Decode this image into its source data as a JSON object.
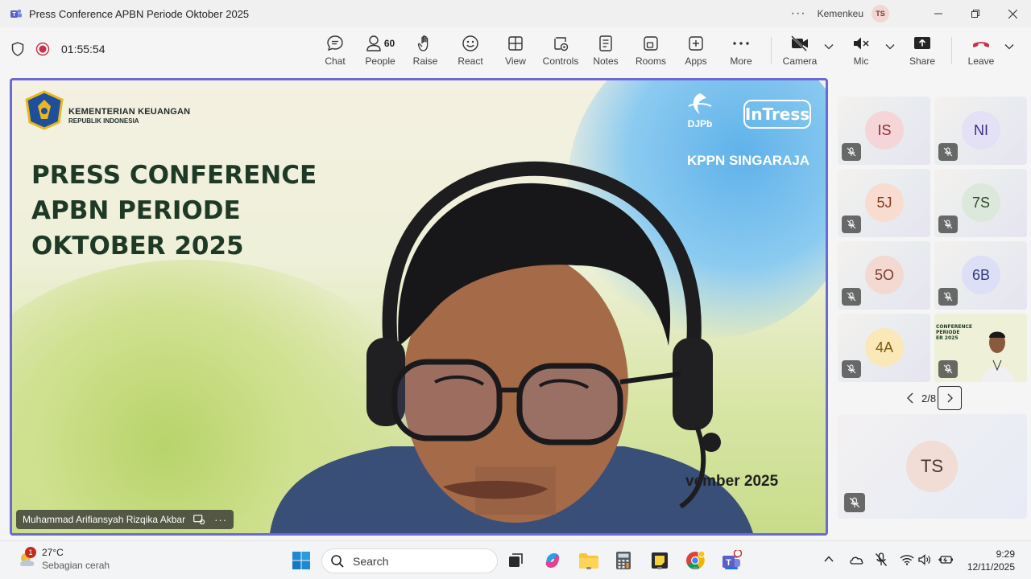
{
  "window": {
    "title": "Press Conference APBN Periode Oktober 2025",
    "org": "Kemenkeu",
    "user_initials": "TS"
  },
  "toolbar": {
    "timer": "01:55:54",
    "people_count": "60",
    "items": {
      "chat": "Chat",
      "people": "People",
      "raise": "Raise",
      "react": "React",
      "view": "View",
      "controls": "Controls",
      "notes": "Notes",
      "rooms": "Rooms",
      "apps": "Apps",
      "more": "More",
      "camera": "Camera",
      "mic": "Mic",
      "share": "Share",
      "leave": "Leave"
    },
    "leave_color": "#c4314b"
  },
  "main_video": {
    "ministry_line1": "KEMENTERIAN KEUANGAN",
    "ministry_line2": "REPUBLIK INDONESIA",
    "title_lines": [
      "PRESS CONFERENCE",
      "APBN PERIODE",
      "OKTOBER 2025"
    ],
    "djpb": "DJPb",
    "intress": "InTress",
    "kppn": "KPPN SINGARAJA",
    "date_fragment": "vember 2025",
    "speaker_name": "Muhammad Arifiansyah Rizqika Akbar",
    "border_color": "#6b69d6"
  },
  "gallery": {
    "tiles": [
      {
        "initials": "IS",
        "bg": "#f6d5d8",
        "fg": "#8a2a35"
      },
      {
        "initials": "NI",
        "bg": "#e4e0f5",
        "fg": "#3b2f7a"
      },
      {
        "initials": "5J",
        "bg": "#f8dcd0",
        "fg": "#8a3a1e"
      },
      {
        "initials": "7S",
        "bg": "#dde8dc",
        "fg": "#2e4a2c"
      },
      {
        "initials": "5O",
        "bg": "#f3d9d2",
        "fg": "#7a3a2a"
      },
      {
        "initials": "6B",
        "bg": "#dcdff5",
        "fg": "#2f3a7a"
      },
      {
        "initials": "4A",
        "bg": "#fbe8b8",
        "fg": "#7a5a10"
      }
    ],
    "pager": "2/8",
    "self_initials": "TS"
  },
  "taskbar": {
    "weather_badge": "1",
    "temperature": "27°C",
    "condition": "Sebagian cerah",
    "search_label": "Search",
    "time": "9:29",
    "date": "12/11/2025"
  }
}
